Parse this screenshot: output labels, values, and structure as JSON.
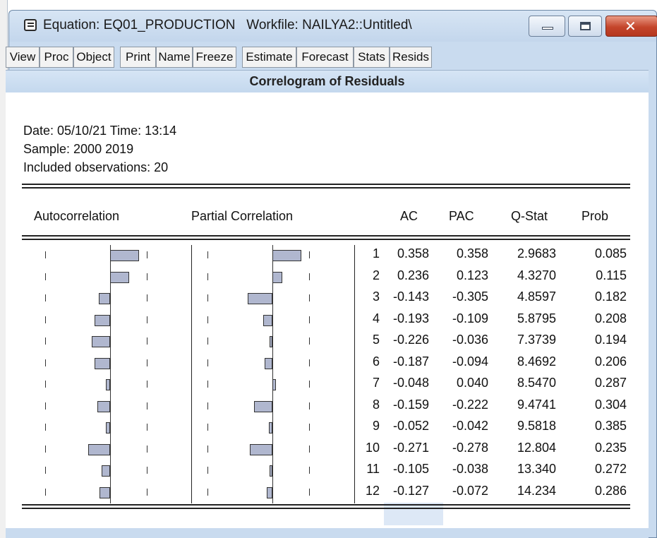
{
  "window": {
    "title": "Equation: EQ01_PRODUCTION   Workfile: NAILYA2::Untitled\\"
  },
  "toolbar": {
    "buttons": [
      "View",
      "Proc",
      "Object",
      "Print",
      "Name",
      "Freeze",
      "Estimate",
      "Forecast",
      "Stats",
      "Resids"
    ]
  },
  "view_title": "Correlogram of Residuals",
  "info": {
    "date_line": "Date: 05/10/21   Time: 13:14",
    "sample_line": "Sample: 2000 2019",
    "obs_line": "Included observations: 20"
  },
  "table": {
    "headers": {
      "autocorrelation": "Autocorrelation",
      "partial_correlation": "Partial Correlation",
      "ac": "AC",
      "pac": "PAC",
      "qstat": "Q-Stat",
      "prob": "Prob"
    },
    "rows": [
      {
        "lag": "1",
        "ac": "0.358",
        "pac": "0.358",
        "q": "2.9683",
        "prob": "0.085"
      },
      {
        "lag": "2",
        "ac": "0.236",
        "pac": "0.123",
        "q": "4.3270",
        "prob": "0.115"
      },
      {
        "lag": "3",
        "ac": "-0.143",
        "pac": "-0.305",
        "q": "4.8597",
        "prob": "0.182"
      },
      {
        "lag": "4",
        "ac": "-0.193",
        "pac": "-0.109",
        "q": "5.8795",
        "prob": "0.208"
      },
      {
        "lag": "5",
        "ac": "-0.226",
        "pac": "-0.036",
        "q": "7.3739",
        "prob": "0.194"
      },
      {
        "lag": "6",
        "ac": "-0.187",
        "pac": "-0.094",
        "q": "8.4692",
        "prob": "0.206"
      },
      {
        "lag": "7",
        "ac": "-0.048",
        "pac": "0.040",
        "q": "8.5470",
        "prob": "0.287"
      },
      {
        "lag": "8",
        "ac": "-0.159",
        "pac": "-0.222",
        "q": "9.4741",
        "prob": "0.304"
      },
      {
        "lag": "9",
        "ac": "-0.052",
        "pac": "-0.042",
        "q": "9.5818",
        "prob": "0.385"
      },
      {
        "lag": "10",
        "ac": "-0.271",
        "pac": "-0.278",
        "q": "12.804",
        "prob": "0.235"
      },
      {
        "lag": "11",
        "ac": "-0.105",
        "pac": "-0.038",
        "q": "13.340",
        "prob": "0.272"
      },
      {
        "lag": "12",
        "ac": "-0.127",
        "pac": "-0.072",
        "q": "14.234",
        "prob": "0.286"
      }
    ]
  },
  "colors": {
    "bar_fill": "#b0b7cf",
    "close_button": "#c4452b",
    "titlebar": "#c9dbef"
  }
}
